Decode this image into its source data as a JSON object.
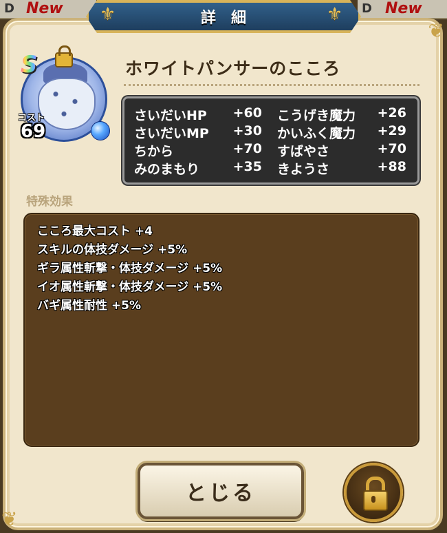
{
  "background_cards": {
    "left": {
      "letter": "D",
      "badge": "New"
    },
    "right": {
      "letter": "D",
      "badge": "New"
    }
  },
  "header": {
    "title": "詳細"
  },
  "item": {
    "name": "ホワイトパンサーのこころ",
    "rank": "S",
    "cost_label": "コスト",
    "cost_value": "69"
  },
  "stats": [
    {
      "name": "さいだいHP",
      "value": "+60"
    },
    {
      "name": "こうげき魔力",
      "value": "+26"
    },
    {
      "name": "さいだいMP",
      "value": "+30"
    },
    {
      "name": "かいふく魔力",
      "value": "+29"
    },
    {
      "name": "ちから",
      "value": "+70"
    },
    {
      "name": "すばやさ",
      "value": "+70"
    },
    {
      "name": "みのまもり",
      "value": "+35"
    },
    {
      "name": "きようさ",
      "value": "+88"
    }
  ],
  "special_effects": {
    "label": "特殊効果",
    "lines": [
      "こころ最大コスト +4",
      "スキルの体技ダメージ +5%",
      "ギラ属性斬撃・体技ダメージ +5%",
      "イオ属性斬撃・体技ダメージ +5%",
      "バギ属性耐性 +5%"
    ]
  },
  "buttons": {
    "close_label": "とじる"
  },
  "icons": {
    "lock": "lock-icon",
    "orb": "blue-orb-icon"
  },
  "colors": {
    "panel": "#f1e6cc",
    "ribbon": "#31608a",
    "effects_bg": "#5a3e1e",
    "stats_bg": "#2c2c2c"
  }
}
